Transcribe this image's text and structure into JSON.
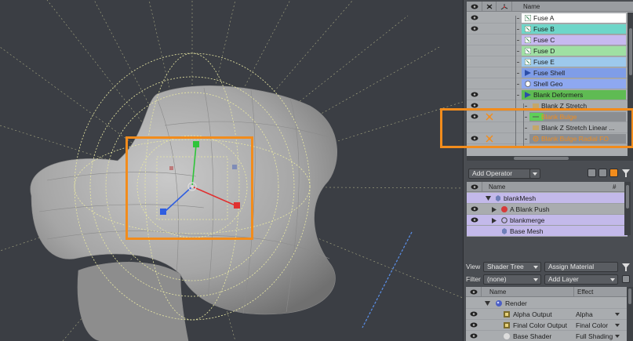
{
  "items_panel": {
    "header_name": "Name",
    "rows": [
      {
        "label": "Fuse A",
        "color": "#ffffff",
        "vis": true
      },
      {
        "label": "Fuse B",
        "color": "#6ed6c9",
        "vis": true
      },
      {
        "label": "Fuse C",
        "color": "#c7b9f0",
        "vis": false
      },
      {
        "label": "Fuse D",
        "color": "#9fe0a3",
        "vis": false
      },
      {
        "label": "Fuse E",
        "color": "#9dc9ec",
        "vis": false
      },
      {
        "label": "Fuse Shell",
        "color": "#7f9de8",
        "vis": false
      },
      {
        "label": "Shell Geo",
        "color": "#8ea8f0",
        "vis": false
      },
      {
        "label": "Blank Deformers",
        "color": "#5fbb53",
        "vis": true
      },
      {
        "label": "Blank Z Stretch",
        "color": "",
        "vis": true
      },
      {
        "label": "Blank Bulge",
        "color": "#8b8e92",
        "vis": true
      },
      {
        "label": "Blank Z Stretch Linear ...",
        "color": "",
        "vis": false
      },
      {
        "label": "Blank Bulge Radial FO",
        "color": "#8b8e92",
        "vis": true
      }
    ]
  },
  "operator_panel": {
    "add_operator": "Add Operator",
    "header_name": "Name",
    "header_hash": "#",
    "rows": [
      {
        "label": "blankMesh"
      },
      {
        "label": "A Blank Push"
      },
      {
        "label": "blankmerge"
      },
      {
        "label": "Base Mesh"
      }
    ]
  },
  "shader_panel": {
    "view_label": "View",
    "view_value": "Shader Tree",
    "assign_material": "Assign Material",
    "filter_label": "Filter",
    "filter_value": "(none)",
    "add_layer": "Add Layer",
    "header_name": "Name",
    "header_effect": "Effect",
    "rows": [
      {
        "label": "Render",
        "effect": ""
      },
      {
        "label": "Alpha Output",
        "effect": "Alpha"
      },
      {
        "label": "Final Color Output",
        "effect": "Final Color"
      },
      {
        "label": "Base Shader",
        "effect": "Full Shading"
      }
    ]
  },
  "colors": {
    "highlight_orange": "#f28c1c",
    "gizmo_green": "#2fc43a",
    "gizmo_red": "#e03030",
    "gizmo_blue": "#2f5ee0",
    "deformer_yellow": "#e9e8a3"
  }
}
